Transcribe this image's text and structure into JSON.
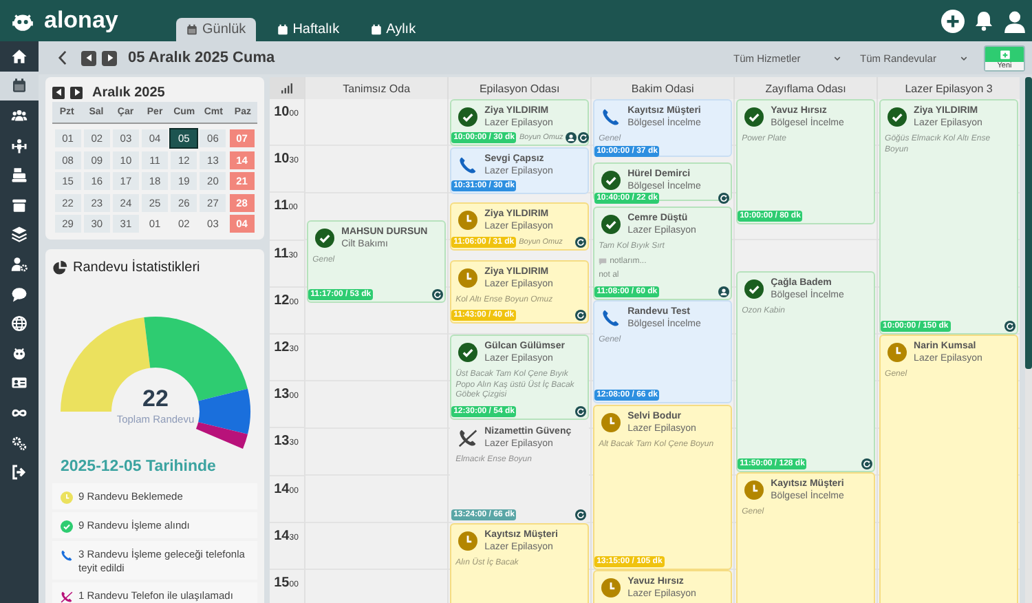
{
  "topbar": {
    "logo": "alonay",
    "tabs": [
      {
        "label": "Günlük",
        "selected": true
      },
      {
        "label": "Haftalık",
        "selected": false
      },
      {
        "label": "Aylık",
        "selected": false
      }
    ]
  },
  "sidebar": {
    "items": [
      {
        "selected": false
      },
      {
        "selected": true
      },
      {
        "selected": false
      },
      {
        "selected": false
      },
      {
        "selected": false
      },
      {
        "selected": false
      },
      {
        "selected": false
      },
      {
        "selected": false
      },
      {
        "selected": false
      },
      {
        "selected": false
      },
      {
        "selected": false
      },
      {
        "selected": false
      },
      {
        "selected": false
      },
      {
        "selected": false
      },
      {
        "selected": false
      }
    ]
  },
  "toolbar": {
    "date": "05 Aralık 2025 Cuma",
    "filters": [
      {
        "value": "Tüm Hizmetler"
      },
      {
        "value": "Tüm Randevular"
      }
    ],
    "new_button": "Yeni"
  },
  "mini_calendar": {
    "title": "Aralık 2025",
    "weekdays": [
      "Pzt",
      "Sal",
      "Çar",
      "Per",
      "Cum",
      "Cmt",
      "Paz"
    ],
    "days": [
      {
        "label": "01",
        "kind": "day",
        "selected": false
      },
      {
        "label": "02",
        "kind": "day",
        "selected": false
      },
      {
        "label": "03",
        "kind": "day",
        "selected": false
      },
      {
        "label": "04",
        "kind": "day",
        "selected": false
      },
      {
        "label": "05",
        "kind": "day",
        "selected": true
      },
      {
        "label": "06",
        "kind": "day",
        "selected": false
      },
      {
        "label": "07",
        "kind": "sunday",
        "selected": false
      },
      {
        "label": "08",
        "kind": "day",
        "selected": false
      },
      {
        "label": "09",
        "kind": "day",
        "selected": false
      },
      {
        "label": "10",
        "kind": "day",
        "selected": false
      },
      {
        "label": "11",
        "kind": "day",
        "selected": false
      },
      {
        "label": "12",
        "kind": "day",
        "selected": false
      },
      {
        "label": "13",
        "kind": "day",
        "selected": false
      },
      {
        "label": "14",
        "kind": "sunday",
        "selected": false
      },
      {
        "label": "15",
        "kind": "day",
        "selected": false
      },
      {
        "label": "16",
        "kind": "day",
        "selected": false
      },
      {
        "label": "17",
        "kind": "day",
        "selected": false
      },
      {
        "label": "18",
        "kind": "day",
        "selected": false
      },
      {
        "label": "19",
        "kind": "day",
        "selected": false
      },
      {
        "label": "20",
        "kind": "day",
        "selected": false
      },
      {
        "label": "21",
        "kind": "sunday",
        "selected": false
      },
      {
        "label": "22",
        "kind": "day",
        "selected": false
      },
      {
        "label": "23",
        "kind": "day",
        "selected": false
      },
      {
        "label": "24",
        "kind": "day",
        "selected": false
      },
      {
        "label": "25",
        "kind": "day",
        "selected": false
      },
      {
        "label": "26",
        "kind": "day",
        "selected": false
      },
      {
        "label": "27",
        "kind": "day",
        "selected": false
      },
      {
        "label": "28",
        "kind": "sunday",
        "selected": false
      },
      {
        "label": "29",
        "kind": "day",
        "selected": false
      },
      {
        "label": "30",
        "kind": "day",
        "selected": false
      },
      {
        "label": "31",
        "kind": "day",
        "selected": false
      },
      {
        "label": "01",
        "kind": "outside",
        "selected": false
      },
      {
        "label": "02",
        "kind": "outside",
        "selected": false
      },
      {
        "label": "03",
        "kind": "outside",
        "selected": false
      },
      {
        "label": "04",
        "kind": "sunday",
        "selected": false
      }
    ]
  },
  "stats": {
    "title": "Randevu İstatistikleri",
    "total": "22",
    "total_label": "Toplam Randevu",
    "date_heading": "2025-12-05 Tarihinde",
    "items": [
      {
        "kind": "waiting",
        "text": "9 Randevu Beklemede",
        "color": "#ebe15e"
      },
      {
        "kind": "done",
        "text": "9 Randevu İşleme alındı",
        "color": "#2ecc71"
      },
      {
        "kind": "confirmed",
        "text": "3 Randevu İşleme geleceği telefonla teyit edildi",
        "color": "#1a6fdc"
      },
      {
        "kind": "unreachable",
        "text": "1 Randevu Telefon ile ulaşılamadı",
        "color": "#b8127a"
      }
    ]
  },
  "schedule": {
    "times": [
      "10$_{00}$",
      "10$_{30}$",
      "11$_{00}$",
      "11$_{30}$",
      "12$_{00}$",
      "12$_{30}$",
      "13$_{00}$",
      "13$_{30}$",
      "14$_{00}$",
      "14$_{30}$",
      "15$_{00}$"
    ],
    "rooms": [
      {
        "name": "Tanimsız Oda",
        "appointments": [
          {
            "name": "MAHSUN DURSUN",
            "service": "Cilt Bakımı",
            "kind": "done",
            "tags": [
              "Genel"
            ],
            "time": "11:17:00 / 53 dk",
            "person_badge": false,
            "cycle_badge": true
          }
        ]
      },
      {
        "name": "Epilasyon Odası",
        "appointments": [
          {
            "name": "Ziya YILDIRIM",
            "service": "Lazer Epilasyon",
            "kind": "done",
            "tags": [
              "Boyun",
              "Omuz"
            ],
            "time": "10:00:00 / 30 dk",
            "person_badge": true,
            "cycle_badge": true
          },
          {
            "name": "Sevgi Çapsız",
            "service": "Lazer Epilasyon",
            "kind": "confirmed",
            "time": "10:31:00 / 30 dk",
            "person_badge": false,
            "cycle_badge": false
          },
          {
            "name": "Ziya YILDIRIM",
            "service": "Lazer Epilasyon",
            "kind": "waiting",
            "tags": [
              "Boyun",
              "Omuz"
            ],
            "time": "11:06:00 / 31 dk",
            "person_badge": false,
            "cycle_badge": true
          },
          {
            "name": "Ziya YILDIRIM",
            "service": "Lazer Epilasyon",
            "kind": "waiting",
            "tags": [
              "Kol Altı",
              "Ense",
              "Boyun",
              "Omuz"
            ],
            "time": "11:43:00 / 40 dk",
            "person_badge": false,
            "cycle_badge": true
          },
          {
            "name": "Gülcan Gülümser",
            "service": "Lazer Epilasyon",
            "kind": "done",
            "tags": [
              "Üst Bacak",
              "Tam Kol",
              "Çene",
              "Bıyık",
              "Popo",
              "Alın",
              "Kaş üstü",
              "Üst İç Bacak",
              "Göbek Çizgisi"
            ],
            "time": "12:30:00 / 54 dk",
            "person_badge": false,
            "cycle_badge": true
          },
          {
            "name": "Nizamettin Güvenç",
            "service": "Lazer Epilasyon",
            "kind": "unreachable",
            "tags": [
              "Elmacık",
              "Ense",
              "Boyun"
            ],
            "time": "13:24:00 / 66 dk",
            "person_badge": false,
            "cycle_badge": true
          },
          {
            "name": "Kayıtsız Müşteri",
            "service": "Lazer Epilasyon",
            "kind": "waiting",
            "tags": [
              "Alın",
              "Üst İç Bacak"
            ],
            "person_badge": false,
            "cycle_badge": false
          }
        ]
      },
      {
        "name": "Bakim Odasi",
        "appointments": [
          {
            "name": "Kayıtsız Müşteri",
            "service": "Bölgesel İncelme",
            "kind": "confirmed",
            "tags": [
              "Genel"
            ],
            "time": "10:00:00 / 37 dk",
            "person_badge": false,
            "cycle_badge": false
          },
          {
            "name": "Hürel Demirci",
            "service": "Bölgesel İncelme",
            "kind": "done",
            "time": "10:40:00 / 22 dk",
            "person_badge": false,
            "cycle_badge": true
          },
          {
            "name": "Cemre Düştü",
            "service": "Lazer Epilasyon",
            "kind": "done",
            "tags": [
              "Tam Kol",
              "Bıyık",
              "Sırt"
            ],
            "note": "notlarım...",
            "note_action": "not al",
            "time": "11:08:00 / 60 dk",
            "person_badge": true,
            "cycle_badge": false
          },
          {
            "name": "Randevu Test",
            "service": "Bölgesel İncelme",
            "kind": "confirmed",
            "tags": [
              "Genel"
            ],
            "time": "12:08:00 / 66 dk",
            "person_badge": false,
            "cycle_badge": false
          },
          {
            "name": "Selvi Bodur",
            "service": "Lazer Epilasyon",
            "kind": "waiting",
            "tags": [
              "Alt Bacak",
              "Tam Kol",
              "Çene",
              "Boyun"
            ],
            "time": "13:15:00 / 105 dk",
            "person_badge": false,
            "cycle_badge": false
          },
          {
            "name": "Yavuz Hırsız",
            "service": "Lazer Epilasyon",
            "kind": "waiting",
            "person_badge": false,
            "cycle_badge": false
          }
        ]
      },
      {
        "name": "Zayıflama Odası",
        "appointments": [
          {
            "name": "Yavuz Hırsız",
            "service": "Bölgesel İncelme",
            "kind": "done",
            "tags": [
              "Power Plate"
            ],
            "time": "10:00:00 / 80 dk",
            "person_badge": false,
            "cycle_badge": false
          },
          {
            "name": "Çağla Badem",
            "service": "Bölgesel İncelme",
            "kind": "done",
            "tags": [
              "Ozon Kabin"
            ],
            "time": "11:50:00 / 128 dk",
            "person_badge": false,
            "cycle_badge": true
          },
          {
            "name": "Kayıtsız Müşteri",
            "service": "Bölgesel İncelme",
            "kind": "waiting",
            "tags": [
              "Genel"
            ],
            "person_badge": false,
            "cycle_badge": false
          }
        ]
      },
      {
        "name": "Lazer Epilasyon 3",
        "appointments": [
          {
            "name": "Ziya YILDIRIM",
            "service": "Lazer Epilasyon",
            "kind": "done",
            "tags": [
              "Göğüs",
              "Elmacık",
              "Kol Altı",
              "Ense",
              "Boyun"
            ],
            "time": "10:00:00 / 150 dk",
            "person_badge": false,
            "cycle_badge": true
          },
          {
            "name": "Narin Kumsal",
            "service": "Lazer Epilasyon",
            "kind": "waiting",
            "tags": [
              "Genel"
            ],
            "person_badge": false,
            "cycle_badge": false
          }
        ]
      }
    ]
  }
}
